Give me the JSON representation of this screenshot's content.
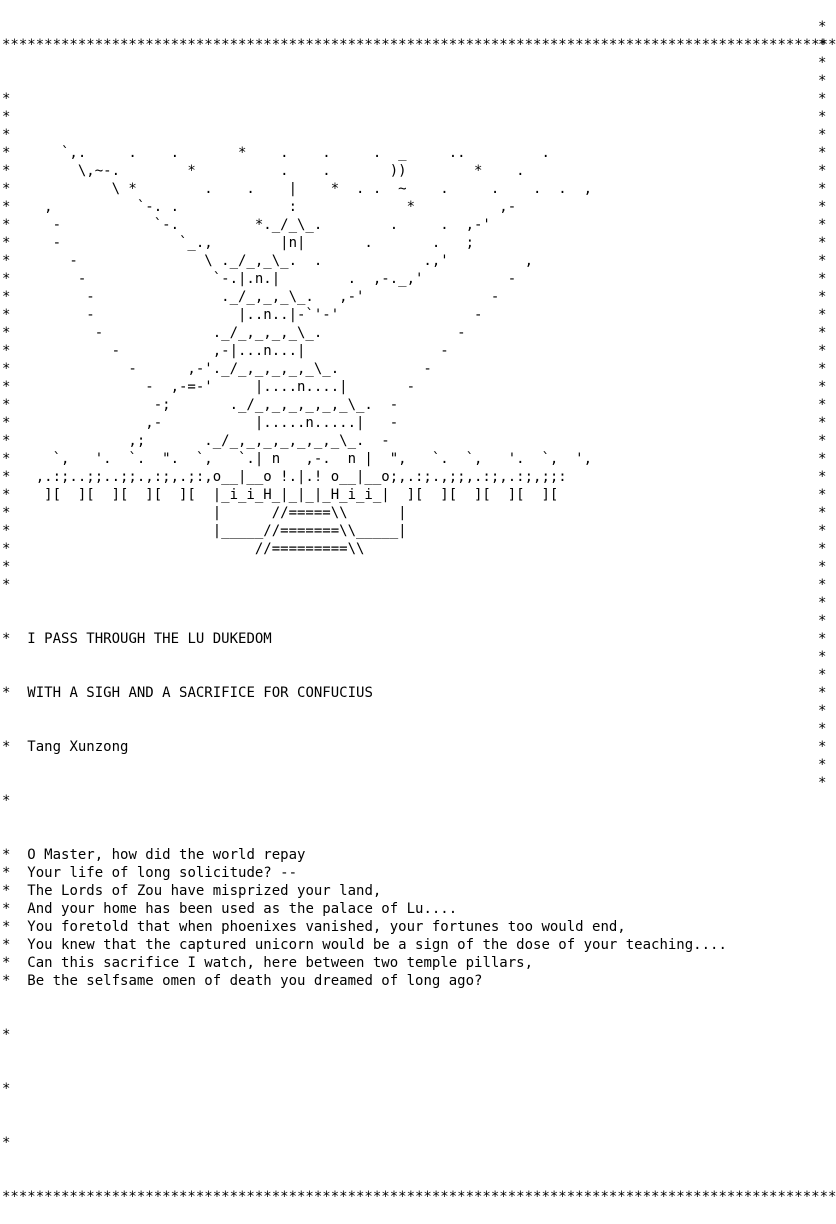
{
  "border_top": "*******************************************************************************************************",
  "border_bottom": "*******************************************************************************************************",
  "art_lines": [
    "*                                                                                                 *",
    "*                                                                                                 *",
    "*                                                                                                 *",
    "*      `,.     .    .       *    .    .     .  _     ..         .                                 *",
    "*        \\,~-.        *          .    .       ))        *    .                                    *",
    "*            \\ *        .    .    |    *  . .  ~    .     .    .  .  ,                           *",
    "*    ,          `-. .             :             *          ,-                                     *",
    "*     -           `-.         *._/_\\_.        .     .  ,-'                                        *",
    "*     -              `_.,        |n|       .       .   ;                                          *",
    "*       -               \\ ._/_,_\\_.  .            .,'         ,                                   *",
    "*        -               `-.|.n.|        .  ,-._,'          -                                     *",
    "*         -               ._/_,_,_\\_.   ,-'               -                                       *",
    "*         -                 |..n..|-`'-'                -                                         *",
    "*          -             ._/_,_,_,_\\_.                -                                           *",
    "*            -           ,-|...n...|                -                                             *",
    "*              -      ,-'._/_,_,_,_,_\\_.          -                                               *",
    "*                -  ,-=-'     |....n....|       -                                                 *",
    "*                 -;       ._/_,_,_,_,_,_\\_.  -                                                   *",
    "*                ,-           |.....n.....|   -                                                   *",
    "*              ,;       ._/_,_,_,_,_,_,_\\_.  -                                                    *",
    "*     `,   '.  `.  \".  `,   `.| n   ,-.  n |  \",   `.  `,   '.  `,  ',                            *",
    "*   ,.:;..;;..;;.,:;,.;:,o__|__o !.|.! o__|__o;,.:;.,;;,.:;,.:;,;;:                               *",
    "*    ][  ][  ][  ][  ][  |_i_i_H_|_|_|_H_i_i_|  ][  ][  ][  ][  ][                                *",
    "*                        |      //=====\\\\      |                                                  *",
    "*                        |_____//=======\\\\_____|                                                  *",
    "*                             //=========\\\\                                                       *",
    "*                                                                                                 *",
    "*                                                                                                 *"
  ],
  "poem": {
    "title_line_1": "I PASS THROUGH THE LU DUKEDOM",
    "title_line_2": "WITH A SIGH AND A SACRIFICE FOR CONFUCIUS",
    "author": "Tang Xunzong",
    "lines": [
      "O Master, how did the world repay",
      "Your life of long solicitude? --",
      "The Lords of Zou have misprized your land,",
      "And your home has been used as the palace of Lu....",
      "You foretold that when phoenixes vanished, your fortunes too would end,",
      "You knew that the captured unicorn would be a sign of the dose of your teaching....",
      "Can this sacrifice I watch, here between two temple pillars,",
      "Be the selfsame omen of death you dreamed of long ago?"
    ]
  }
}
